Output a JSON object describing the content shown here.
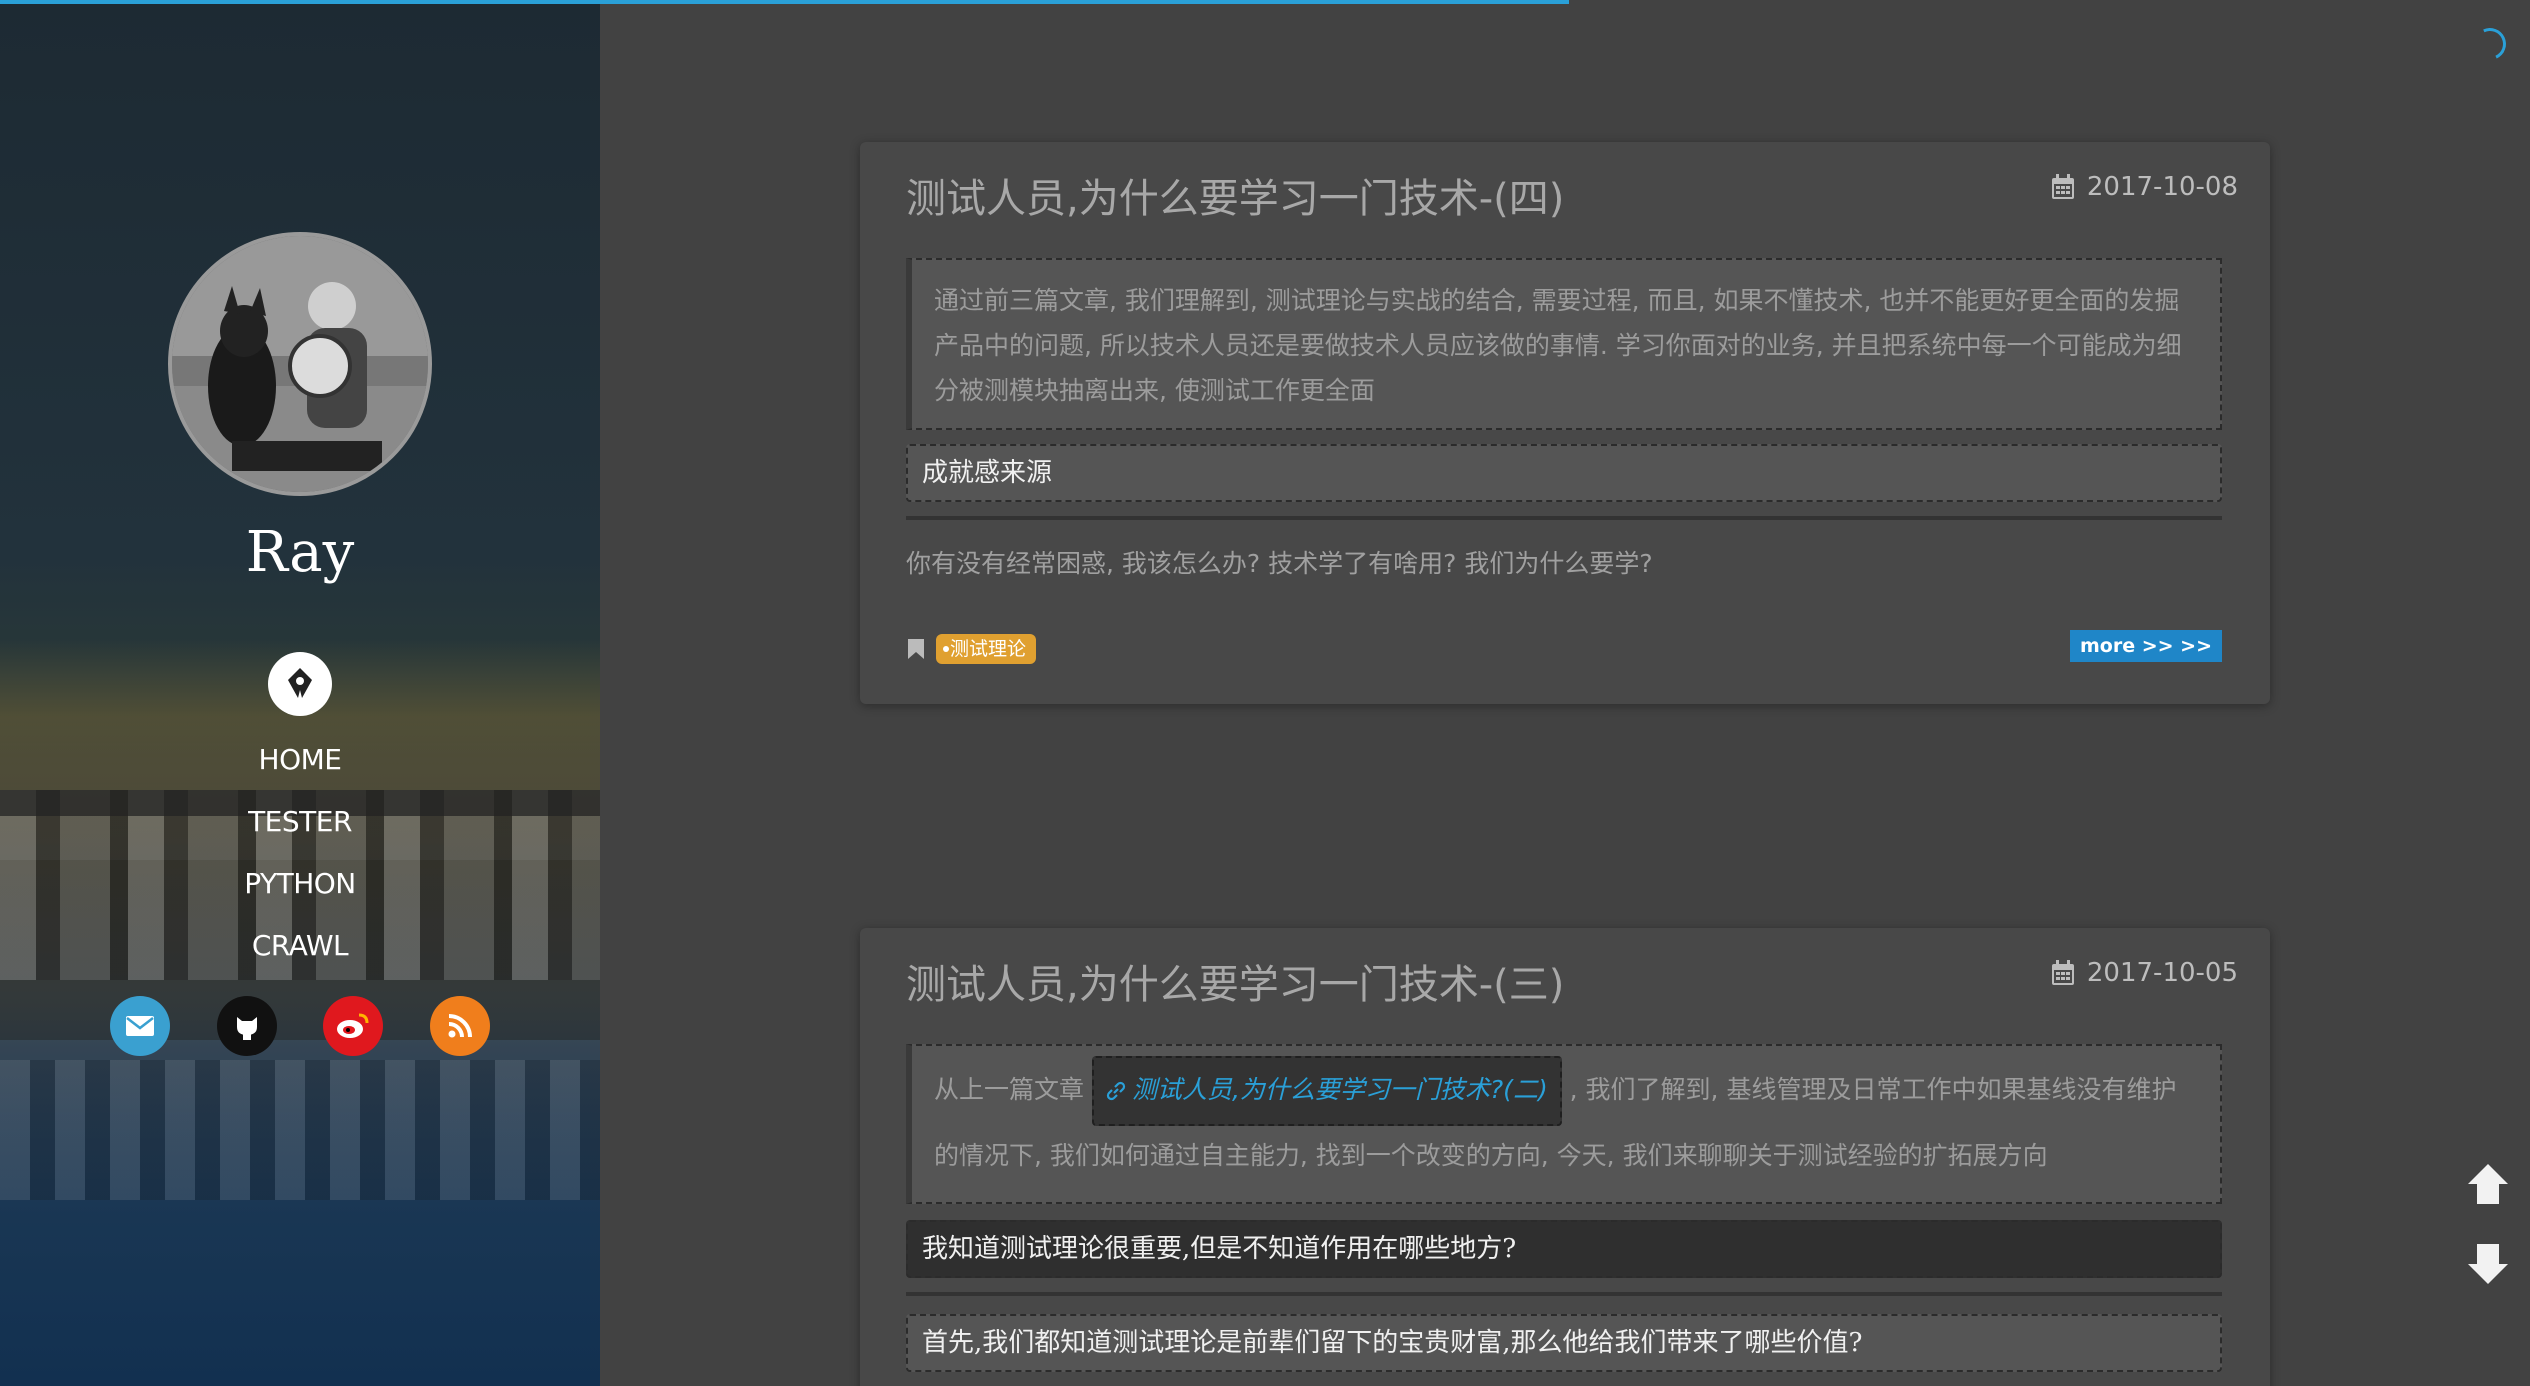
{
  "progress": {
    "percent": 62
  },
  "sidebar": {
    "author": "Ray",
    "nav": [
      "HOME",
      "TESTER",
      "PYTHON",
      "CRAWL"
    ],
    "socials": [
      {
        "name": "email-icon",
        "color": "#3aa0d0"
      },
      {
        "name": "github-icon",
        "color": "#111111"
      },
      {
        "name": "weibo-icon",
        "color": "#e0181e"
      },
      {
        "name": "rss-icon",
        "color": "#f07e1c"
      }
    ]
  },
  "posts": [
    {
      "title": "测试人员,为什么要学习一门技术-(四)",
      "date": "2017-10-08",
      "quote": "通过前三篇文章, 我们理解到, 测试理论与实战的结合, 需要过程, 而且, 如果不懂技术, 也并不能更好更全面的发掘产品中的问题, 所以技术人员还是要做技术人员应该做的事情. 学习你面对的业务, 并且把系统中每一个可能成为细分被测模块抽离出来, 使测试工作更全面",
      "heading": "成就感来源",
      "excerpt": "你有没有经常困惑, 我该怎么办? 技术学了有啥用? 我们为什么要学?",
      "tag": "测试理论",
      "more": "more >> >>"
    },
    {
      "title": "测试人员,为什么要学习一门技术-(三)",
      "date": "2017-10-05",
      "quote_before": "从上一篇文章",
      "quote_link": "测试人员,为什么要学习一门技术?(二)",
      "quote_after": ", 我们了解到, 基线管理及日常工作中如果基线没有维护的情况下, 我们如何通过自主能力, 找到一个改变的方向, 今天, 我们来聊聊关于测试经验的扩拓展方向",
      "heading": "我知道测试理论很重要,但是不知道作用在哪些地方?",
      "heading2": "首先,我们都知道测试理论是前辈们留下的宝贵财富,那么他给我们带来了哪些价值?"
    }
  ]
}
